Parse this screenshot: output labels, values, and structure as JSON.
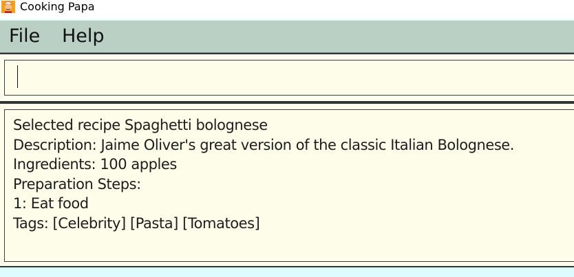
{
  "window": {
    "title": "Cooking Papa",
    "icon": "chef-icon"
  },
  "menu": {
    "file_label": "File",
    "help_label": "Help"
  },
  "command": {
    "value": "",
    "placeholder": ""
  },
  "result": {
    "lines": [
      "Selected recipe Spaghetti bolognese",
      "Description: Jaime Oliver's great version of the classic Italian Bolognese.",
      "Ingredients: 100 apples",
      "Preparation Steps:",
      "1: Eat food",
      "Tags: [Celebrity] [Pasta] [Tomatoes]"
    ]
  },
  "colors": {
    "menubar": "#bad0c4",
    "panel_background": "#fefde9",
    "window_background": "#dffcfc"
  }
}
